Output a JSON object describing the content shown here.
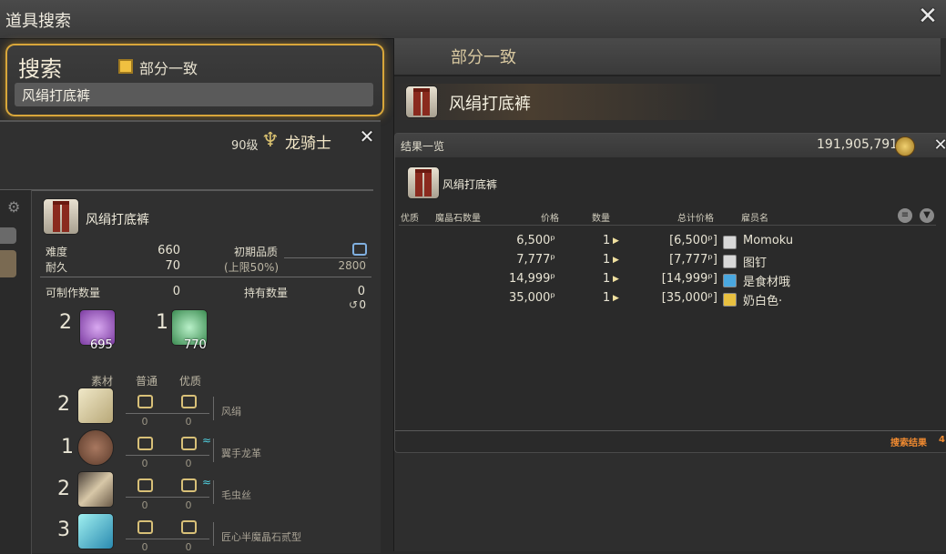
{
  "window": {
    "title": "道具搜索"
  },
  "search": {
    "label": "搜索",
    "partial_match_label": "部分一致",
    "partial_match_checked": true,
    "query": "风绢打底裤"
  },
  "crafting": {
    "level": "90级",
    "job": "龙骑士",
    "item_name": "风绢打底裤",
    "difficulty_label": "难度",
    "difficulty": "660",
    "durability_label": "耐久",
    "durability": "70",
    "initial_quality_label": "初期品质",
    "quality_cap_label": "(上限50%)",
    "quality_cap": "2800",
    "craftable_label": "可制作数量",
    "craftable": "0",
    "owned_label": "持有数量",
    "owned": "0",
    "owned_sub": "0",
    "crystals": [
      {
        "need": "2",
        "have": "695",
        "color": "#c080e0"
      },
      {
        "need": "1",
        "have": "770",
        "color": "#70d090"
      }
    ],
    "mat_header": "素材",
    "nq_header": "普通",
    "hq_header": "优质",
    "materials": [
      {
        "need": "2",
        "name": "风绢",
        "nq": "0",
        "hq": "0",
        "hq_marker": false
      },
      {
        "need": "1",
        "name": "翼手龙革",
        "nq": "0",
        "hq": "0",
        "hq_marker": true
      },
      {
        "need": "2",
        "name": "毛虫丝",
        "nq": "0",
        "hq": "0",
        "hq_marker": true
      },
      {
        "need": "3",
        "name": "匠心半魔晶石贰型",
        "nq": "0",
        "hq": "0",
        "hq_marker": false
      }
    ]
  },
  "market": {
    "header": "部分一致",
    "item_name": "风绢打底裤",
    "results_title": "结果一览",
    "gil": "191,905,791",
    "list_item_name": "风绢打底裤",
    "columns": [
      "优质",
      "魔晶石数量",
      "价格",
      "数量",
      "总计价格",
      "雇员名"
    ],
    "listings": [
      {
        "price": "6,500ᵖ",
        "qty": "1",
        "total": "[6,500ᵖ]",
        "retainer": "Momoku",
        "icon_color": "#d8d8d8"
      },
      {
        "price": "7,777ᵖ",
        "qty": "1",
        "total": "[7,777ᵖ]",
        "retainer": "图钉",
        "icon_color": "#d8d8d8"
      },
      {
        "price": "14,999ᵖ",
        "qty": "1",
        "total": "[14,999ᵖ]",
        "retainer": "是食材哦",
        "icon_color": "#4aa8e0"
      },
      {
        "price": "35,000ᵖ",
        "qty": "1",
        "total": "[35,000ᵖ]",
        "retainer": "奶白色·",
        "icon_color": "#e8c040"
      }
    ],
    "search_results_label": "搜索结果",
    "search_results_count": "4"
  },
  "icons": {
    "close": "close-icon",
    "job": "dragoon-job-icon",
    "gear": "gear-icon",
    "gil": "gil-coin-icon",
    "sort": "sort-icon",
    "filter": "filter-icon"
  }
}
